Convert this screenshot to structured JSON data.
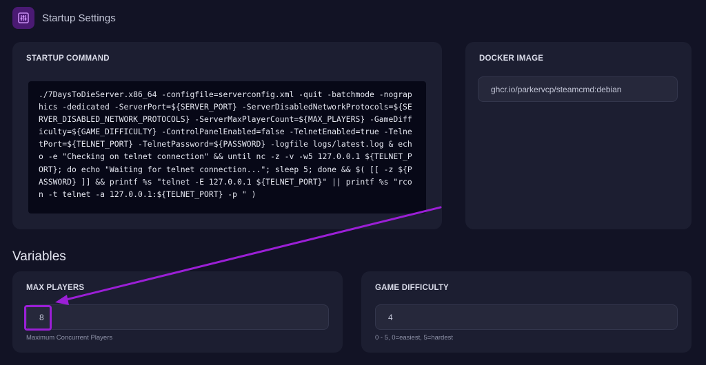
{
  "header": {
    "title": "Startup Settings",
    "icon": "sliders-icon"
  },
  "startup": {
    "label": "STARTUP COMMAND",
    "command": "./7DaysToDieServer.x86_64 -configfile=serverconfig.xml -quit -batchmode -nographics -dedicated -ServerPort=${SERVER_PORT} -ServerDisabledNetworkProtocols=${SERVER_DISABLED_NETWORK_PROTOCOLS} -ServerMaxPlayerCount=${MAX_PLAYERS} -GameDifficulty=${GAME_DIFFICULTY} -ControlPanelEnabled=false -TelnetEnabled=true -TelnetPort=${TELNET_PORT} -TelnetPassword=${PASSWORD} -logfile logs/latest.log & echo -e \"Checking on telnet connection\" && until nc -z -v -w5 127.0.0.1 ${TELNET_PORT}; do echo \"Waiting for telnet connection...\"; sleep 5; done && $( [[ -z ${PASSWORD} ]] && printf %s \"telnet -E 127.0.0.1 ${TELNET_PORT}\" || printf %s \"rcon -t telnet -a 127.0.0.1:${TELNET_PORT} -p \" )"
  },
  "docker": {
    "label": "DOCKER IMAGE",
    "value": "ghcr.io/parkervcp/steamcmd:debian"
  },
  "variables": {
    "title": "Variables",
    "max_players": {
      "label": "MAX PLAYERS",
      "value": "8",
      "hint": "Maximum Concurrent Players"
    },
    "game_difficulty": {
      "label": "GAME DIFFICULTY",
      "value": "4",
      "hint": "0 - 5, 0=easiest, 5=hardest"
    }
  },
  "colors": {
    "accent": "#9b1fd6",
    "background": "#121325",
    "card": "#1c1e31",
    "code_bg": "#070817"
  }
}
